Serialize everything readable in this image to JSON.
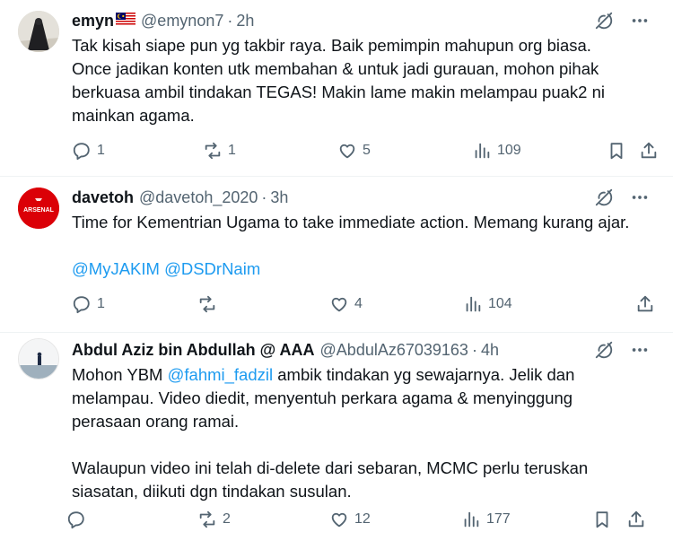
{
  "tweets": [
    {
      "name": "emyn",
      "flag_icon": "malaysia-flag-icon",
      "handle": "@emynon7",
      "separator": "·",
      "time": "2h",
      "lines": [
        "Tak kisah siape pun yg takbir raya. Baik pemimpin mahupun org biasa.",
        "Once jadikan konten utk membahan & untuk jadi gurauan, mohon pihak",
        "berkuasa ambil tindakan TEGAS! Makin lame makin melampau puak2 ni",
        "mainkan agama."
      ],
      "replies": "1",
      "reposts": "1",
      "likes": "5",
      "views": "109"
    },
    {
      "name": "davetoh",
      "handle": "@davetoh_2020",
      "separator": "·",
      "time": "3h",
      "avatar_text": "ARSENAL",
      "line1": "Time for Kementrian Ugama to take immediate action. Memang kurang ajar.",
      "mention1": "@MyJAKIM",
      "mention2": "@DSDrNaim",
      "replies": "1",
      "reposts": "",
      "likes": "4",
      "views": "104"
    },
    {
      "name": "Abdul Aziz bin Abdullah @ AAA",
      "handle": "@AbdulAz67039163",
      "separator": "·",
      "time": "4h",
      "p1_prefix": "Mohon YBM ",
      "p1_mention": "@fahmi_fadzil",
      "p1_suffix": " ambik tindakan yg sewajarnya. Jelik dan",
      "p1_line2": "melampau. Video diedit, menyentuh perkara agama & menyinggung",
      "p1_line3": "perasaan orang ramai.",
      "p2_line1": "Walaupun video ini telah di-delete dari sebaran, MCMC perlu teruskan",
      "p2_line2": "siasatan, diikuti dgn tindakan susulan.",
      "replies": "",
      "reposts": "2",
      "likes": "12",
      "views": "177"
    }
  ],
  "colors": {
    "text": "#0f1419",
    "secondary": "#536471",
    "link": "#1d9bf0",
    "arsenal_red": "#db0007"
  }
}
